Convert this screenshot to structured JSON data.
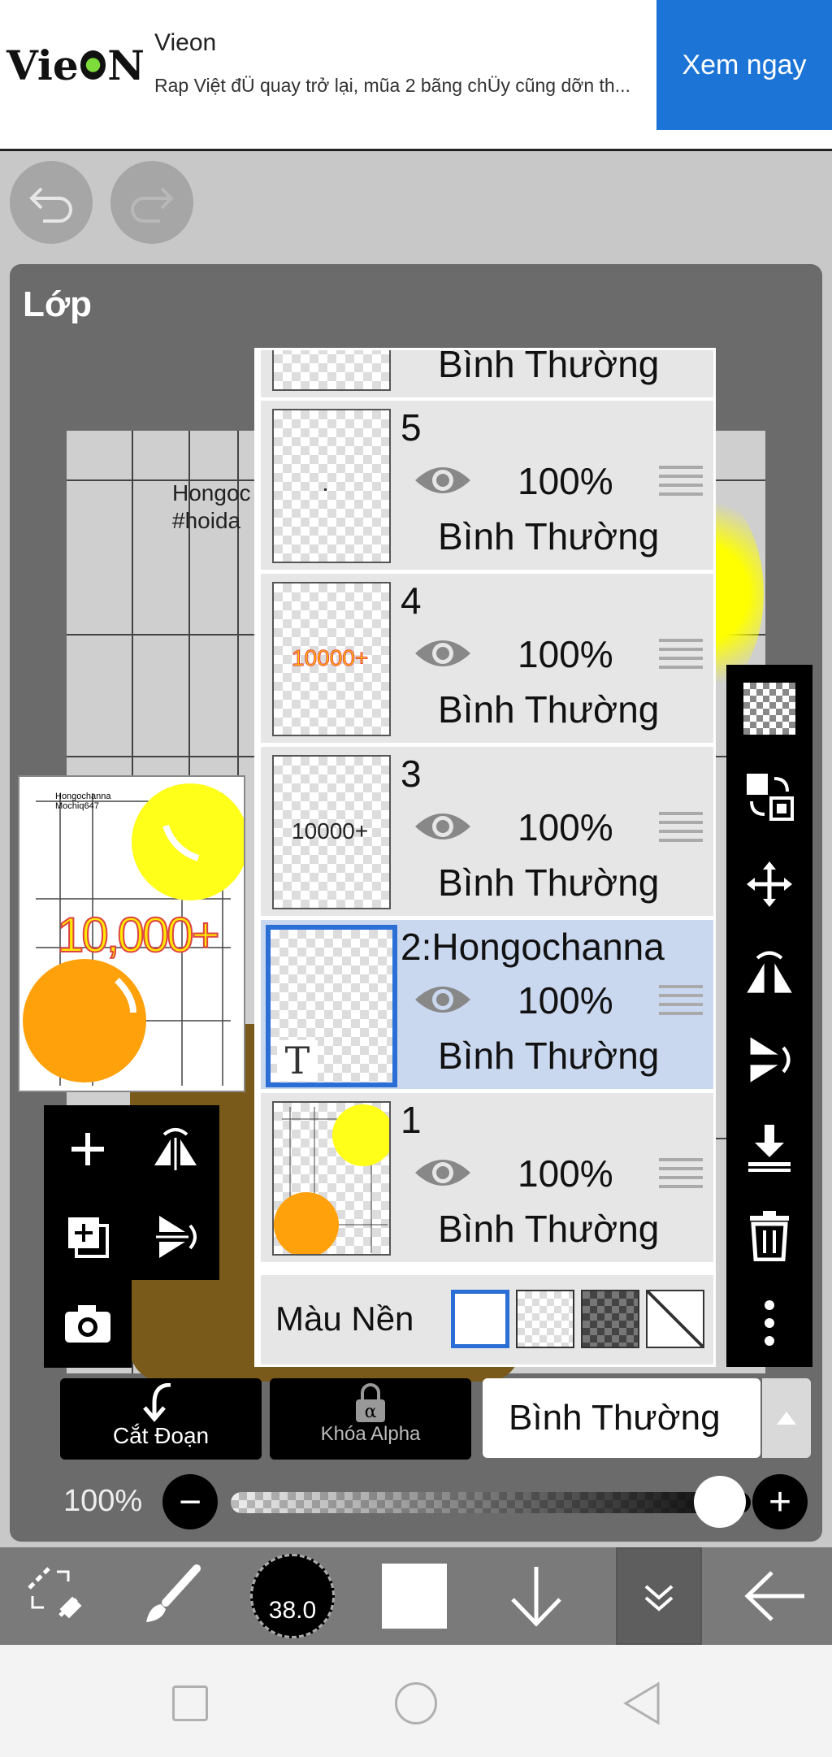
{
  "ad": {
    "brand_logo": "VieON",
    "title": "Vieon",
    "description": "Rap Việt đÜ quay trở lại, mũa 2 bãng chÜy cũng dỡn th...",
    "cta": "Xem ngay"
  },
  "history": {
    "undo_icon": "undo-icon",
    "redo_icon": "redo-icon"
  },
  "panel": {
    "title": "Lớp"
  },
  "canvas_text": {
    "line1": "Hongoc",
    "line2": "#hoida"
  },
  "thumbnail": {
    "big_text": "10,000+",
    "small_text_1": "Hongochanna",
    "small_text_2": "Mochiq647"
  },
  "layers": [
    {
      "name": "",
      "opacity": "",
      "mode": "Bình Thường",
      "partial": true
    },
    {
      "name": "5",
      "opacity": "100%",
      "mode": "Bình Thường",
      "thumb_text": ""
    },
    {
      "name": "4",
      "opacity": "100%",
      "mode": "Bình Thường",
      "thumb_text": "10000+"
    },
    {
      "name": "3",
      "opacity": "100%",
      "mode": "Bình Thường",
      "thumb_text": "10000+"
    },
    {
      "name": "2:Hongochanna",
      "opacity": "100%",
      "mode": "Bình Thường",
      "selected": true,
      "thumb_text": "T"
    },
    {
      "name": "1",
      "opacity": "100%",
      "mode": "Bình Thường"
    }
  ],
  "background": {
    "label": "Màu Nền"
  },
  "bottom": {
    "cut_label": "Cắt Đoạn",
    "alpha_label": "Khóa Alpha",
    "blend_mode": "Bình Thường",
    "opacity_label": "100%",
    "opacity_value": 1.0,
    "minus": "−",
    "plus": "+"
  },
  "toolbar": {
    "brush_size": "38.0"
  },
  "colors": {
    "accent": "#1b74d6",
    "selected_layer": "#c9d7ef",
    "selection_border": "#2b6fd6"
  }
}
